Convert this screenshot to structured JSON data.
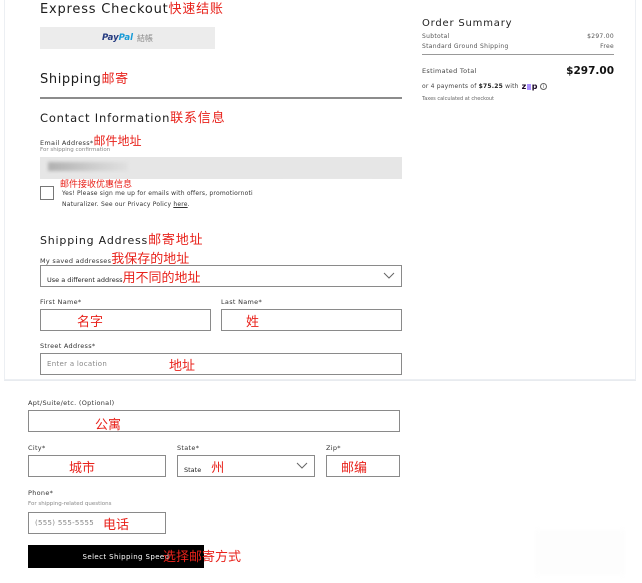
{
  "express_checkout": {
    "title": "Express Checkout",
    "title_cn": "快速结账",
    "paypal_button": {
      "brand_pay": "Pay",
      "brand_pal": "Pal",
      "label_cn": "結帳"
    }
  },
  "shipping": {
    "title": "Shipping",
    "title_cn": "邮寄"
  },
  "contact": {
    "title": "Contact Information",
    "title_cn": "联系信息",
    "email_label": "Email Address*",
    "email_label_cn": "邮件地址",
    "email_sublabel": "For shipping confirmation",
    "optin_cn": "邮件接收优惠信息",
    "optin_text_line1": "Yes! Please sign me up for emails with offers, promotiornoti",
    "optin_text_line2_prefix": "Naturalizer. See our Privacy Policy ",
    "optin_link": "here",
    "optin_text_suffix": "."
  },
  "shipping_address": {
    "title": "Shipping Address",
    "title_cn": "邮寄地址",
    "saved_label": "My saved addresses",
    "saved_label_cn": "我保存的地址",
    "saved_value": "Use a different address",
    "saved_value_cn": "用不同的地址",
    "first_name_label": "First Name*",
    "first_name_cn": "名字",
    "last_name_label": "Last Name*",
    "last_name_cn": "姓",
    "street_label": "Street Address*",
    "street_placeholder": "Enter a location",
    "street_cn": "地址",
    "apt_label": "Apt/Suite/etc. (Optional)",
    "apt_cn": "公寓",
    "city_label": "City*",
    "city_cn": "城市",
    "state_label": "State*",
    "state_value": "State",
    "state_cn": "州",
    "zip_label": "Zip*",
    "zip_cn": "邮编",
    "phone_label": "Phone*",
    "phone_sublabel": "For shipping-related questions",
    "phone_placeholder": "(555) 555-5555",
    "phone_cn": "电话",
    "submit_label": "Select Shipping Speed",
    "submit_cn": "选择邮寄方式"
  },
  "order_summary": {
    "title": "Order Summary",
    "subtotal_label": "Subtotal",
    "subtotal_value": "$297.00",
    "shipping_label": "Standard Ground Shipping",
    "shipping_value": "Free",
    "total_label": "Estimated Total",
    "total_value": "$297.00",
    "installment_prefix": "or 4 payments of ",
    "installment_amount": "$75.25",
    "installment_suffix": " with",
    "zip_brand_z": "z",
    "zip_brand_p": "p",
    "info_glyph": "i",
    "taxes_note": "Taxes calculated at checkout"
  },
  "colors": {
    "annotation": "#e8221b",
    "button_bg": "#000000",
    "paypal_blue_dark": "#253b80",
    "paypal_blue_light": "#179bd7",
    "zip_purple": "#aa8fff"
  }
}
